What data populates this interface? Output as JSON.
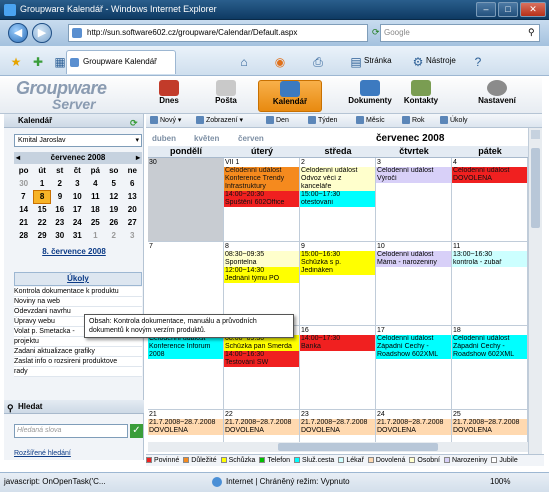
{
  "window": {
    "title": "Groupware Kalendář - Windows Internet Explorer"
  },
  "browser": {
    "url": "http://sun.software602.cz/groupware/Calendar/Default.aspx",
    "search_placeholder": "Google",
    "tab_label": "Groupware Kalendář",
    "menu_stranka": "Stránka",
    "menu_nastroje": "Nástroje"
  },
  "app": {
    "logo_line1": "Groupware",
    "logo_line2": "Server",
    "modules": [
      "Dnes",
      "Pošta",
      "Kalendář",
      "Dokumenty",
      "Kontakty",
      "Nastavení"
    ],
    "selected_module": "Kalendář"
  },
  "sidebar": {
    "header": "Kalendář",
    "user": "Kmital Jaroslav",
    "minical": {
      "month": "červenec 2008",
      "weekdays": [
        "po",
        "út",
        "st",
        "čt",
        "pá",
        "so",
        "ne"
      ],
      "weeks": [
        [
          "30",
          "1",
          "2",
          "3",
          "4",
          "5",
          "6"
        ],
        [
          "7",
          "8",
          "9",
          "10",
          "11",
          "12",
          "13"
        ],
        [
          "14",
          "15",
          "16",
          "17",
          "18",
          "19",
          "20"
        ],
        [
          "21",
          "22",
          "23",
          "24",
          "25",
          "26",
          "27"
        ],
        [
          "28",
          "29",
          "30",
          "31",
          "1",
          "2",
          "3"
        ]
      ],
      "today": "8"
    },
    "date_link": "8. července 2008",
    "tasks_header": "Úkoly",
    "tasks": [
      "Kontrola dokumentace k produktu",
      "Noviny na web",
      "Odevzdani navrhu",
      "Úpravy webu",
      "Volat p. Smetacka - ",
      "projektu",
      "Zadani aktualizace grafiky",
      "Zaslat info o rozsireni produktove",
      "rady"
    ],
    "search_header": "Hledat",
    "search_placeholder": "Hledaná slova",
    "advanced_search": "Rozšířené hledání"
  },
  "toolbar": {
    "buttons": [
      "Nový",
      "Zobrazení",
      "Den",
      "Týden",
      "Měsíc",
      "Rok",
      "Úkoly"
    ]
  },
  "calendar": {
    "month_nav": [
      "duben",
      "květen",
      "červen"
    ],
    "month_title": "červenec 2008",
    "day_headers": [
      "pondělí",
      "úterý",
      "středa",
      "čtvrtek",
      "pátek"
    ],
    "weeks": [
      {
        "days": [
          {
            "n": "30",
            "gray": true,
            "events": []
          },
          {
            "n": "VII 1",
            "events": [
              {
                "t": "Celodenní událost",
                "c": "org"
              },
              {
                "t": "Konference Trendy",
                "c": "org"
              },
              {
                "t": "Infrastruktury",
                "c": "org"
              },
              {
                "t": "14:00~20:30",
                "c": "red"
              },
              {
                "t": "Spuštění 602Office",
                "c": "red"
              }
            ]
          },
          {
            "n": "2",
            "events": [
              {
                "t": "Celodenní událost",
                "c": "lyel"
              },
              {
                "t": "Odvoz věcí z",
                "c": "lyel"
              },
              {
                "t": "kanceláře",
                "c": "lyel"
              },
              {
                "t": "15:00~17:30",
                "c": "cyn"
              },
              {
                "t": "otestovani",
                "c": "cyn"
              }
            ]
          },
          {
            "n": "3",
            "events": [
              {
                "t": "Celodenní událost",
                "c": "lav"
              },
              {
                "t": "Výročí",
                "c": "lav"
              }
            ]
          },
          {
            "n": "4",
            "events": [
              {
                "t": "Celodenní událost",
                "c": "red"
              },
              {
                "t": "DOVOLENÁ",
                "c": "red"
              }
            ]
          }
        ]
      },
      {
        "days": [
          {
            "n": "7",
            "events": []
          },
          {
            "n": "8",
            "events": [
              {
                "t": "08:30~09:35",
                "c": "lyel"
              },
              {
                "t": "Sporitelna",
                "c": "lyel"
              },
              {
                "t": "12:00~14:30",
                "c": "yel"
              },
              {
                "t": "Jednání týmu PO",
                "c": "yel"
              }
            ]
          },
          {
            "n": "9",
            "events": [
              {
                "t": "15:00~16:30",
                "c": "yel"
              },
              {
                "t": "Schůzka s p.",
                "c": "yel"
              },
              {
                "t": "Jedináken",
                "c": "yel"
              }
            ]
          },
          {
            "n": "10",
            "events": [
              {
                "t": "Celodenní událost",
                "c": "lav"
              },
              {
                "t": "Máma - narozeniny",
                "c": "lav"
              }
            ]
          },
          {
            "n": "11",
            "events": [
              {
                "t": "13:00~16:30",
                "c": "lcyn"
              },
              {
                "t": "kontrola - zubař",
                "c": "lcyn"
              }
            ]
          }
        ]
      },
      {
        "days": [
          {
            "n": "",
            "events": [
              {
                "t": "Celodenní událost",
                "c": "cyn"
              },
              {
                "t": "Konference Inforum",
                "c": "cyn"
              },
              {
                "t": "2008",
                "c": "cyn"
              }
            ]
          },
          {
            "n": "",
            "events": [
              {
                "t": "08:00~09:30",
                "c": "yel"
              },
              {
                "t": "Schůzka pan Šmerda",
                "c": "yel"
              },
              {
                "t": "14:00~16:30",
                "c": "red"
              },
              {
                "t": "Testování SW",
                "c": "red"
              }
            ]
          },
          {
            "n": "16",
            "events": [
              {
                "t": "14:00~17:30",
                "c": "red"
              },
              {
                "t": "Banka",
                "c": "red"
              }
            ]
          },
          {
            "n": "17",
            "events": [
              {
                "t": "Celodenní událost",
                "c": "cyn"
              },
              {
                "t": "Západní Čechy -",
                "c": "cyn"
              },
              {
                "t": "Roadshow 602XML",
                "c": "cyn"
              }
            ]
          },
          {
            "n": "18",
            "events": [
              {
                "t": "Celodenní událost",
                "c": "cyn"
              },
              {
                "t": "Západní Čechy -",
                "c": "cyn"
              },
              {
                "t": "Roadshow 602XML",
                "c": "cyn"
              }
            ]
          }
        ]
      },
      {
        "days": [
          {
            "n": "21",
            "events": [
              {
                "t": "21.7.2008~28.7.2008",
                "c": "pch"
              },
              {
                "t": "DOVOLENÁ",
                "c": "pch"
              }
            ]
          },
          {
            "n": "22",
            "events": [
              {
                "t": "21.7.2008~28.7.2008",
                "c": "pch"
              },
              {
                "t": "DOVOLENÁ",
                "c": "pch"
              }
            ]
          },
          {
            "n": "23",
            "events": [
              {
                "t": "21.7.2008~28.7.2008",
                "c": "pch"
              },
              {
                "t": "DOVOLENÁ",
                "c": "pch"
              }
            ]
          },
          {
            "n": "24",
            "events": [
              {
                "t": "21.7.2008~28.7.2008",
                "c": "pch"
              },
              {
                "t": "DOVOLENÁ",
                "c": "pch"
              }
            ]
          },
          {
            "n": "25",
            "events": [
              {
                "t": "21.7.2008~28.7.2008",
                "c": "pch"
              },
              {
                "t": "DOVOLENÁ",
                "c": "pch"
              }
            ]
          }
        ]
      }
    ]
  },
  "tooltip": {
    "line1": "Obsah: Kontrola dokumentace, manuálu a průvodních",
    "line2": "dokumentů k novým verzím produktů."
  },
  "legend": [
    {
      "label": "Povinné",
      "color": "#f02020"
    },
    {
      "label": "Důležité",
      "color": "#f58a1e"
    },
    {
      "label": "Schůzka",
      "color": "#ffff00"
    },
    {
      "label": "Telefon",
      "color": "#00c000"
    },
    {
      "label": "Služ.cesta",
      "color": "#00ffff"
    },
    {
      "label": "Lékař",
      "color": "#ccffff"
    },
    {
      "label": "Dovolená",
      "color": "#ffd9b0"
    },
    {
      "label": "Osobní",
      "color": "#ffffcc"
    },
    {
      "label": "Narozeniny",
      "color": "#d8d0f8"
    },
    {
      "label": "Jubile",
      "color": "#ffffff"
    }
  ],
  "status": {
    "left": "javascript: OnOpenTask('C...",
    "zone": "Internet | Chráněný režim: Vypnuto",
    "zoom": "100%"
  }
}
